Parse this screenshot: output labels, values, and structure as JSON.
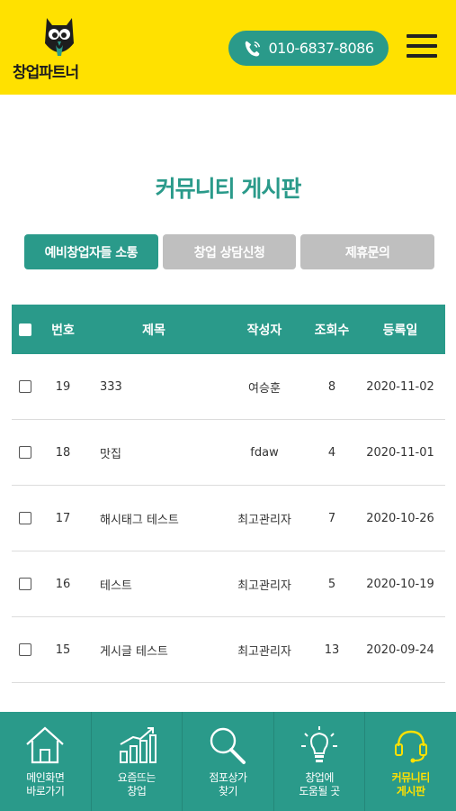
{
  "header": {
    "logo_text": "창업파트너",
    "phone": "010-6837-8086"
  },
  "page_title": "커뮤니티 게시판",
  "tabs": [
    {
      "label": "예비창업자들 소통",
      "active": true
    },
    {
      "label": "창업 상담신청",
      "active": false
    },
    {
      "label": "제휴문의",
      "active": false
    }
  ],
  "table": {
    "headers": {
      "no": "번호",
      "title": "제목",
      "writer": "작성자",
      "views": "조회수",
      "date": "등록일"
    },
    "rows": [
      {
        "no": "19",
        "title": "333",
        "writer": "여승훈",
        "views": "8",
        "date": "2020-11-02"
      },
      {
        "no": "18",
        "title": "맛집",
        "writer": "fdaw",
        "views": "4",
        "date": "2020-11-01"
      },
      {
        "no": "17",
        "title": "해시태그 테스트",
        "writer": "최고관리자",
        "views": "7",
        "date": "2020-10-26"
      },
      {
        "no": "16",
        "title": "테스트",
        "writer": "최고관리자",
        "views": "5",
        "date": "2020-10-19"
      },
      {
        "no": "15",
        "title": "게시글 테스트",
        "writer": "최고관리자",
        "views": "13",
        "date": "2020-09-24"
      }
    ]
  },
  "bottom_nav": [
    {
      "line1": "메인화면",
      "line2": "바로가기",
      "icon": "home-icon"
    },
    {
      "line1": "요즘뜨는",
      "line2": "창업",
      "icon": "chart-icon"
    },
    {
      "line1": "점포상가",
      "line2": "찾기",
      "icon": "search-icon"
    },
    {
      "line1": "창업에",
      "line2": "도움될 곳",
      "icon": "lightbulb-icon"
    },
    {
      "line1": "커뮤니티",
      "line2": "게시판",
      "icon": "headset-icon",
      "active": true
    }
  ],
  "colors": {
    "brand_yellow": "#ffe100",
    "brand_teal": "#2a9a8a",
    "tab_inactive": "#bfbfbf"
  }
}
